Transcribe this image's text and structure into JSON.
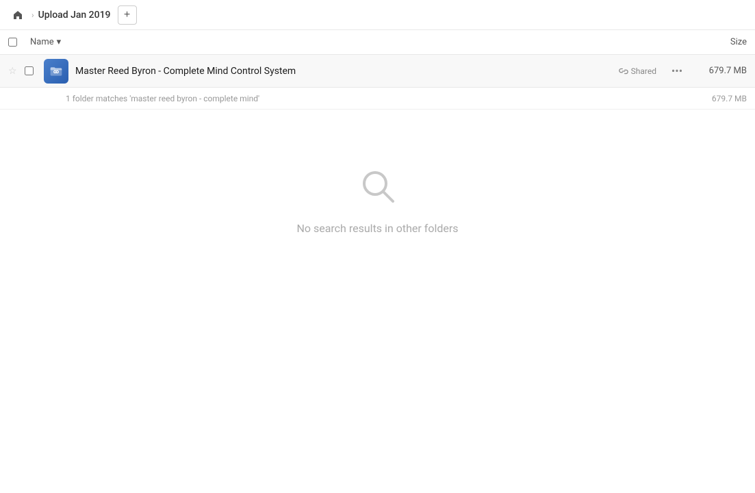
{
  "breadcrumb": {
    "home_icon": "home",
    "chevron": "›",
    "title": "Upload Jan 2019",
    "add_button_label": "+"
  },
  "column_headers": {
    "name_label": "Name",
    "sort_icon": "▾",
    "size_label": "Size"
  },
  "file_row": {
    "star_icon": "☆",
    "name": "Master Reed Byron - Complete Mind Control System",
    "shared_label": "Shared",
    "more_icon": "···",
    "size": "679.7 MB"
  },
  "match_row": {
    "text": "1 folder matches 'master reed byron - complete mind'",
    "size": "679.7 MB"
  },
  "empty_state": {
    "message": "No search results in other folders"
  }
}
